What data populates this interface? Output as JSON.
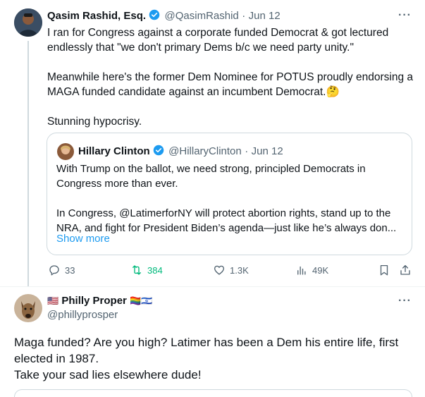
{
  "tweet": {
    "author_name": "Qasim Rashid, Esq.",
    "handle": "@QasimRashid",
    "date": "Jun 12",
    "lines": [
      "I ran for Congress against a corporate funded Democrat & got lectured",
      "endlessly that \"we don't primary Dems b/c we need party unity.\"",
      "",
      "Meanwhile here's the former Dem Nominee for POTUS proudly endorsing a",
      "MAGA funded candidate against an incumbent Democrat.🤔",
      "",
      "Stunning hypocrisy."
    ],
    "quote": {
      "author_name": "Hillary Clinton",
      "handle": "@HillaryClinton",
      "date": "Jun 12",
      "lines": [
        "With Trump on the ballot, we need strong, principled Democrats in",
        "Congress more than ever.",
        "",
        "In Congress, @LatimerforNY will protect abortion rights, stand up to the",
        "NRA, and fight for President Biden’s agenda—just like he’s always don..."
      ],
      "show_more": "Show more"
    },
    "actions": {
      "replies": "33",
      "reposts": "384",
      "likes": "1.3K",
      "views": "49K"
    },
    "colors": {
      "verified": "#1d9bf0",
      "repost": "#00ba7c",
      "link": "#1d9bf0"
    }
  },
  "reply": {
    "author_name": "Philly Proper",
    "flags": "🇺🇸 🏳️‍🌈🇮🇱",
    "handle": "@phillyprosper",
    "lines": [
      "Maga funded? Are you high? Latimer has been a Dem his entire life, first",
      "elected in 1987.",
      "Take your sad lies elsewhere dude!"
    ]
  },
  "icons": [
    "more-icon",
    "verified-icon",
    "reply-icon",
    "repost-icon",
    "like-icon",
    "views-icon",
    "bookmark-icon",
    "share-icon"
  ]
}
